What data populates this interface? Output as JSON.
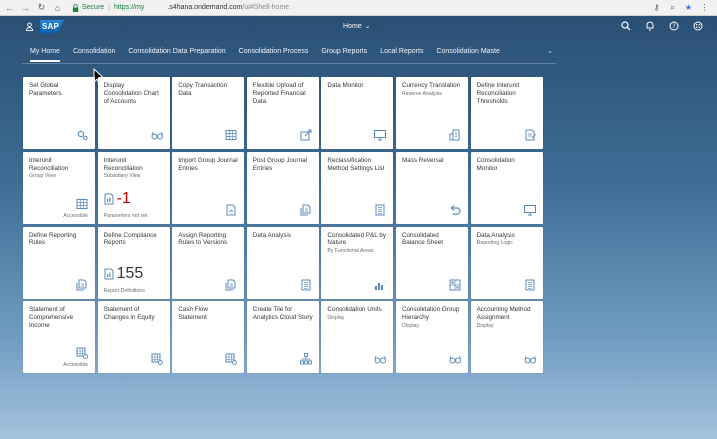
{
  "browser": {
    "secure_label": "Secure",
    "separator": "|",
    "url_protocol": "https://my",
    "url_host": ".s4hana.ondemand.com",
    "url_path": "/ui#Shell-home"
  },
  "shell": {
    "logo_text": "SAP",
    "home_title": "Home",
    "home_chevron": "⌄"
  },
  "tabs": [
    {
      "label": "My Home"
    },
    {
      "label": "Consolidation"
    },
    {
      "label": "Consolidation Data Preparation"
    },
    {
      "label": "Consolidation Process"
    },
    {
      "label": "Group Reports"
    },
    {
      "label": "Local Reports"
    },
    {
      "label": "Consolidation Maste"
    }
  ],
  "tiles": [
    {
      "title": "Set Global Parameters",
      "subtitle": "",
      "footer": "",
      "icon": "gears-icon"
    },
    {
      "title": "Display Consolidation Chart of Accounts",
      "subtitle": "",
      "footer": "",
      "icon": "glasses-icon"
    },
    {
      "title": "Copy Transaction Data",
      "subtitle": "",
      "footer": "",
      "icon": "table-icon"
    },
    {
      "title": "Flexible Upload of Reported Financial Data",
      "subtitle": "",
      "footer": "",
      "icon": "upload-icon"
    },
    {
      "title": "Data Monitor",
      "subtitle": "",
      "footer": "",
      "icon": "monitor-icon"
    },
    {
      "title": "Currency Translation",
      "subtitle": "Reserve Analysis",
      "footer": "",
      "icon": "building-icon"
    },
    {
      "title": "Define Interunit Reconciliation Thresholds",
      "subtitle": "",
      "footer": "",
      "icon": "document-edit-icon"
    },
    {
      "title": "Interunit Reconciliation",
      "subtitle": "Group View",
      "footer": "Accessible",
      "icon": "table-icon"
    },
    {
      "title": "Interunit Reconciliation",
      "subtitle": "Subsidiary View",
      "footer": "Parameters not set",
      "icon": "",
      "kpi": "-1",
      "kpi_icon": "report-icon"
    },
    {
      "title": "Import Group Journal Entries",
      "subtitle": "",
      "footer": "",
      "icon": "document-icon"
    },
    {
      "title": "Post Group Journal Entries",
      "subtitle": "",
      "footer": "",
      "icon": "document-post-icon"
    },
    {
      "title": "Reclassification Method Settings List",
      "subtitle": "",
      "footer": "",
      "icon": "list-icon"
    },
    {
      "title": "Mass Reversal",
      "subtitle": "",
      "footer": "",
      "icon": "undo-icon"
    },
    {
      "title": "Consolidation Monitor",
      "subtitle": "",
      "footer": "",
      "icon": "monitor-icon"
    },
    {
      "title": "Define Reporting Rules",
      "subtitle": "",
      "footer": "",
      "icon": "document-post-icon"
    },
    {
      "title": "Define Compliance Reports",
      "subtitle": "",
      "footer": "Report Definitions",
      "icon": "",
      "kpi": "155",
      "kpi_icon": "report-icon"
    },
    {
      "title": "Assign Reporting Rules to Versions",
      "subtitle": "",
      "footer": "",
      "icon": "document-post-icon"
    },
    {
      "title": "Data Analysis",
      "subtitle": "",
      "footer": "",
      "icon": "list-icon"
    },
    {
      "title": "Consolidated P&L by Nature",
      "subtitle": "By Functional Areas",
      "footer": "",
      "icon": "bar-chart-icon"
    },
    {
      "title": "Consolidated Balance Sheet",
      "subtitle": "",
      "footer": "",
      "icon": "balance-icon"
    },
    {
      "title": "Data Analysis",
      "subtitle": "Reporting Logic",
      "footer": "",
      "icon": "list-icon"
    },
    {
      "title": "Statement of Comprehensive Income",
      "subtitle": "",
      "footer": "Accessible",
      "icon": "grid-settings-icon"
    },
    {
      "title": "Statement of Changes in Equity",
      "subtitle": "",
      "footer": "",
      "icon": "grid-settings-icon"
    },
    {
      "title": "Cash Flow Statement",
      "subtitle": "",
      "footer": "",
      "icon": "grid-settings-icon"
    },
    {
      "title": "Create Tile for Analytics Cloud Story",
      "subtitle": "",
      "footer": "",
      "icon": "hierarchy-icon"
    },
    {
      "title": "Consolidation Units",
      "subtitle": "Display",
      "footer": "",
      "icon": "glasses-icon"
    },
    {
      "title": "Consolidation Group Hierarchy",
      "subtitle": "Display",
      "footer": "",
      "icon": "glasses-icon"
    },
    {
      "title": "Accounting Method Assignment",
      "subtitle": "Display",
      "footer": "",
      "icon": "glasses-icon"
    }
  ],
  "colors": {
    "accent": "#5a88b8",
    "kpi_negative": "#bb0000",
    "shell_bg": "#355f86"
  }
}
